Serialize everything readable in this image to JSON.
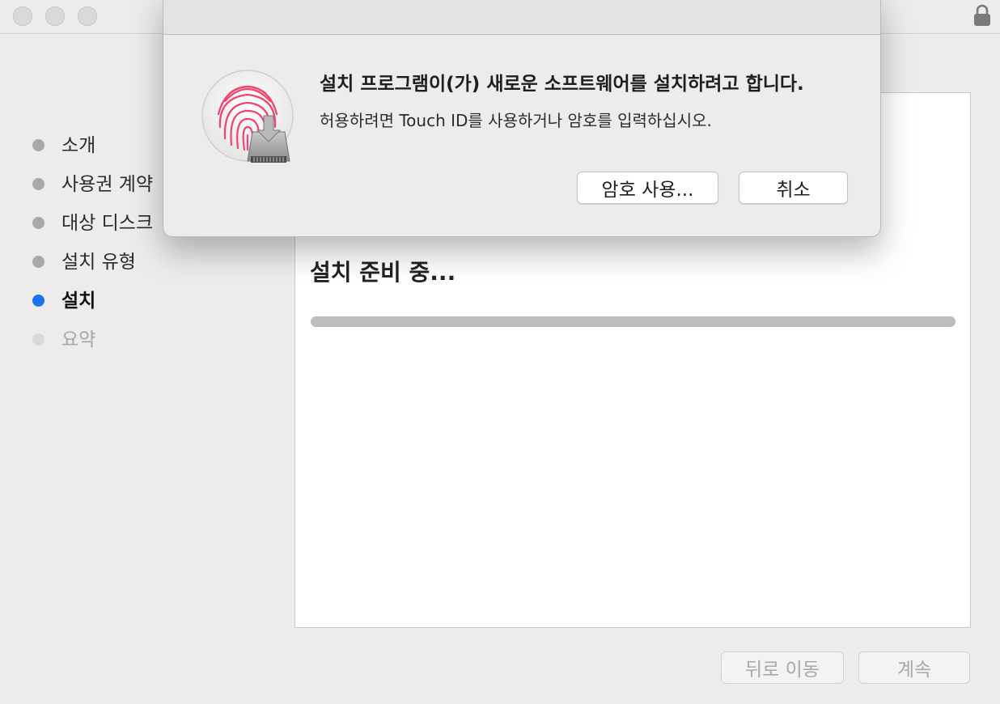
{
  "window": {
    "traffic_lights": [
      "close",
      "minimize",
      "zoom"
    ],
    "lock_icon": "lock-icon"
  },
  "sidebar": {
    "steps": [
      {
        "label": "소개",
        "state": "done"
      },
      {
        "label": "사용권 계약",
        "state": "done"
      },
      {
        "label": "대상 디스크",
        "state": "done"
      },
      {
        "label": "설치 유형",
        "state": "done"
      },
      {
        "label": "설치",
        "state": "current"
      },
      {
        "label": "요약",
        "state": "pending"
      }
    ]
  },
  "content": {
    "title": "설치 준비 중...",
    "progress": 1.0
  },
  "footer": {
    "back_label": "뒤로 이동",
    "continue_label": "계속"
  },
  "dialog": {
    "icon": "touch-id-fingerprint-icon",
    "title": "설치 프로그램이(가) 새로운 소프트웨어를 설치하려고 합니다.",
    "message": "허용하려면 Touch ID를 사용하거나 암호를 입력하십시오.",
    "use_password_label": "암호 사용...",
    "cancel_label": "취소"
  },
  "colors": {
    "accent": "#1a74ee",
    "fingerprint": "#f0446c"
  }
}
